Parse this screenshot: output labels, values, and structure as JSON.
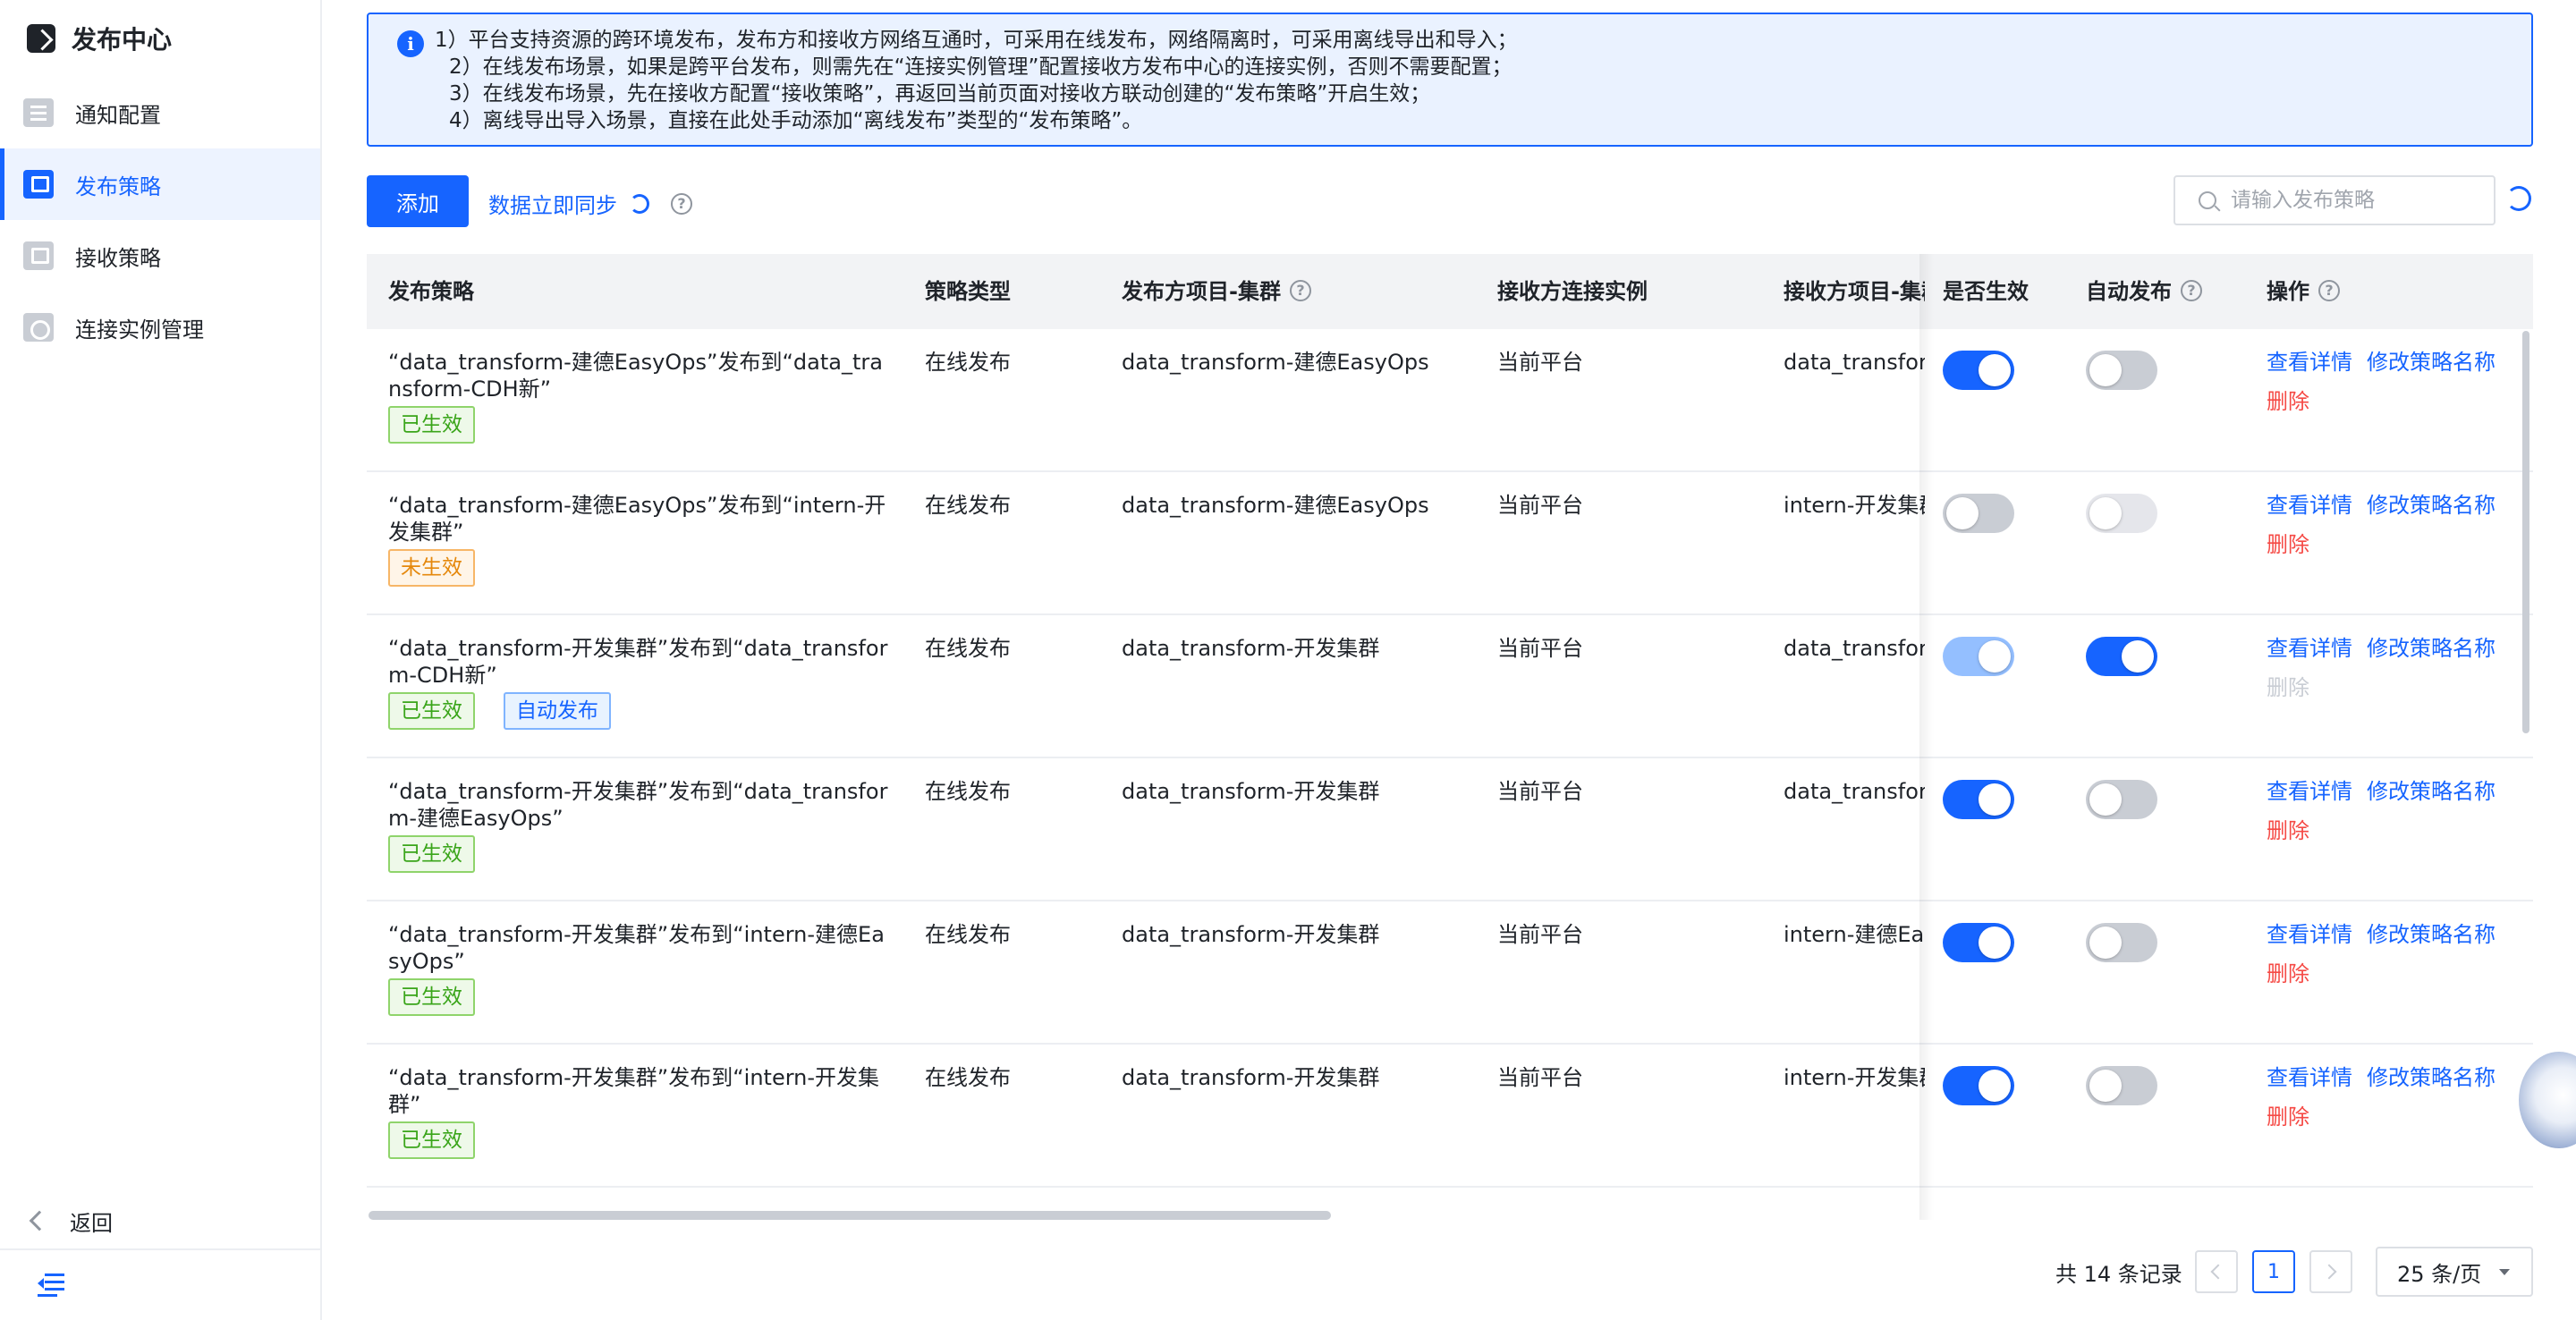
{
  "app": {
    "title": "发布中心"
  },
  "sidebar": {
    "items": [
      {
        "label": "通知配置",
        "icon": "notification-config-icon"
      },
      {
        "label": "发布策略",
        "icon": "publish-strategy-icon",
        "active": true
      },
      {
        "label": "接收策略",
        "icon": "receive-strategy-icon"
      },
      {
        "label": "连接实例管理",
        "icon": "connection-instance-icon"
      }
    ],
    "back_label": "返回"
  },
  "info": {
    "lines": [
      "1）平台支持资源的跨环境发布，发布方和接收方网络互通时，可采用在线发布，网络隔离时，可采用离线导出和导入；",
      "2）在线发布场景，如果是跨平台发布，则需先在“连接实例管理”配置接收方发布中心的连接实例，否则不需要配置；",
      "3）在线发布场景，先在接收方配置“接收策略”，再返回当前页面对接收方联动创建的“发布策略”开启生效；",
      "4）离线导出导入场景，直接在此处手动添加“离线发布”类型的“发布策略”。"
    ]
  },
  "toolbar": {
    "add_label": "添加",
    "sync_label": "数据立即同步",
    "search_placeholder": "请输入发布策略"
  },
  "table": {
    "headers": {
      "strategy": "发布策略",
      "type": "策略类型",
      "source": "发布方项目-集群",
      "conn": "接收方连接实例",
      "target": "接收方项目-集群",
      "enabled": "是否生效",
      "auto": "自动发布",
      "ops": "操作"
    },
    "ops": {
      "detail": "查看详情",
      "rename": "修改策略名称",
      "delete": "删除"
    },
    "tag_labels": {
      "effective": "已生效",
      "not_effective": "未生效",
      "auto": "自动发布"
    },
    "rows": [
      {
        "strategy": "“data_transform-建德EasyOps”发布到“data_transform-CDH新”",
        "type": "在线发布",
        "source": "data_transform-建德EasyOps",
        "conn": "当前平台",
        "target": "data_transform-CDH新",
        "enabled": true,
        "auto": false,
        "status": "已生效",
        "auto_tag": "",
        "delete_disabled": false
      },
      {
        "strategy": "“data_transform-建德EasyOps”发布到“intern-开发集群”",
        "type": "在线发布",
        "source": "data_transform-建德EasyOps",
        "conn": "当前平台",
        "target": "intern-开发集群",
        "enabled": false,
        "auto": false,
        "status": "未生效",
        "auto_tag": "",
        "delete_disabled": false
      },
      {
        "strategy": "“data_transform-开发集群”发布到“data_transform-CDH新”",
        "type": "在线发布",
        "source": "data_transform-开发集群",
        "conn": "当前平台",
        "target": "data_transform-CDH新",
        "enabled": true,
        "auto": true,
        "status": "已生效",
        "auto_tag": "自动发布",
        "delete_disabled": true
      },
      {
        "strategy": "“data_transform-开发集群”发布到“data_transform-建德EasyOps”",
        "type": "在线发布",
        "source": "data_transform-开发集群",
        "conn": "当前平台",
        "target": "data_transform-建德EasyOps",
        "enabled": true,
        "auto": false,
        "status": "已生效",
        "auto_tag": "",
        "delete_disabled": false
      },
      {
        "strategy": "“data_transform-开发集群”发布到“intern-建德EasyOps”",
        "type": "在线发布",
        "source": "data_transform-开发集群",
        "conn": "当前平台",
        "target": "intern-建德EasyOps",
        "enabled": true,
        "auto": false,
        "status": "已生效",
        "auto_tag": "",
        "delete_disabled": false
      },
      {
        "strategy": "“data_transform-开发集群”发布到“intern-开发集群”",
        "type": "在线发布",
        "source": "data_transform-开发集群",
        "conn": "当前平台",
        "target": "intern-开发集群",
        "enabled": true,
        "auto": false,
        "status": "已生效",
        "auto_tag": "",
        "delete_disabled": false
      }
    ]
  },
  "pagination": {
    "total_text": "共 14 条记录",
    "current_page": "1",
    "page_size": "25 条/页"
  },
  "colors": {
    "primary": "#1664ff",
    "success": "#3aa51a",
    "warning": "#e5880c",
    "danger": "#f54a45"
  }
}
